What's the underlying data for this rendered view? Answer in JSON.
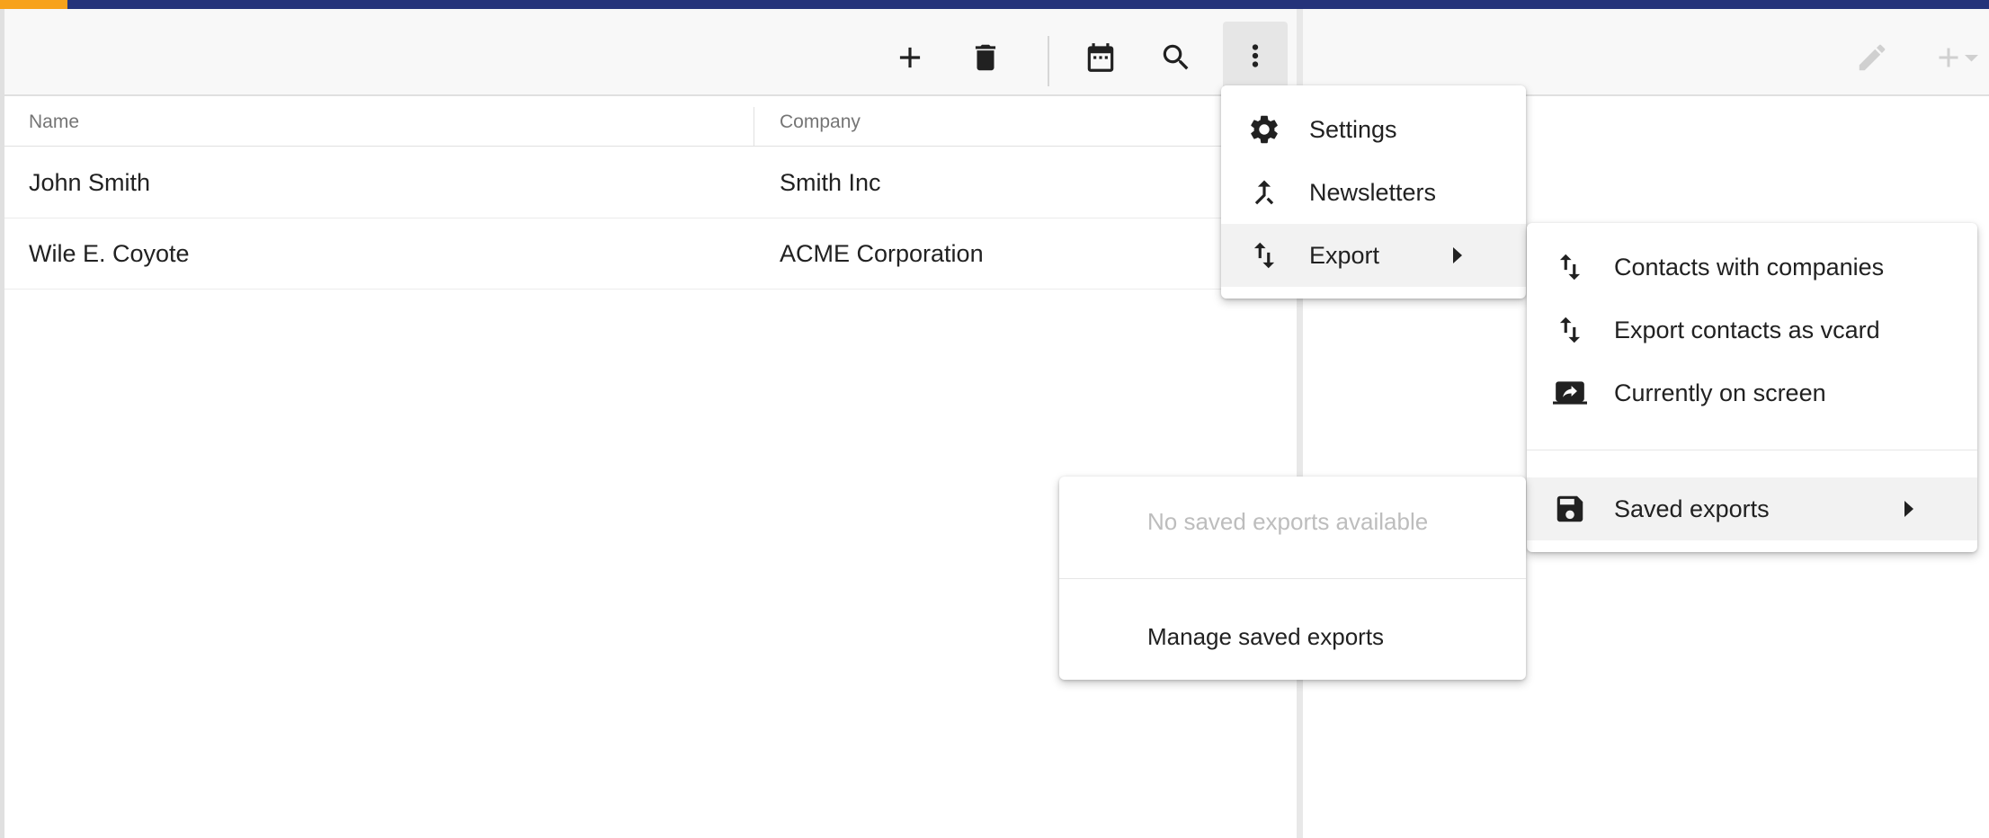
{
  "toolbar": {
    "icons": {
      "add": "plus-icon",
      "delete": "trash-icon",
      "calendar": "calendar-icon",
      "search": "search-icon",
      "more": "more-vertical-icon",
      "edit": "pencil-icon",
      "add_dropdown": "plus-dropdown-icon"
    }
  },
  "grid": {
    "columns": [
      "Name",
      "Company"
    ],
    "rows": [
      {
        "name": "John Smith",
        "company": "Smith Inc"
      },
      {
        "name": "Wile E. Coyote",
        "company": "ACME Corporation"
      }
    ]
  },
  "main_menu": {
    "items": [
      {
        "label": "Settings",
        "icon": "gear-icon"
      },
      {
        "label": "Newsletters",
        "icon": "merge-icon"
      },
      {
        "label": "Export",
        "icon": "import-export-icon"
      }
    ]
  },
  "export_menu": {
    "items": [
      {
        "label": "Contacts with companies",
        "icon": "import-export-icon"
      },
      {
        "label": "Export contacts as vcard",
        "icon": "import-export-icon"
      },
      {
        "label": "Currently on screen",
        "icon": "screen-share-icon"
      },
      {
        "label": "Saved exports",
        "icon": "floppy-disk-icon"
      }
    ]
  },
  "saved_menu": {
    "empty_text": "No saved exports available",
    "manage_label": "Manage saved exports"
  },
  "colors": {
    "topbar": "#25337a",
    "topbar_accent": "#f7a21b",
    "toolbar_bg": "#f8f8f8",
    "highlight": "#f2f2f2"
  }
}
